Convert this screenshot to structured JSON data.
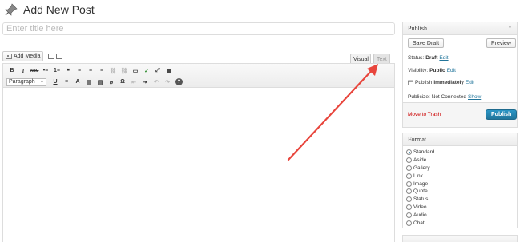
{
  "page": {
    "title": "Add New Post"
  },
  "title_field": {
    "placeholder": "Enter title here"
  },
  "media": {
    "add_media_label": "Add Media"
  },
  "editor_tabs": {
    "visual": "Visual",
    "text": "Text"
  },
  "toolbar": {
    "row1": [
      "B",
      "I",
      "ABC",
      "•≡",
      "1≡",
      "❝",
      "≡",
      "≡",
      "≡",
      "⛓",
      "⛓",
      "▭",
      "✓",
      "⤢",
      "▦"
    ],
    "paragraph_select": "Paragraph",
    "row2": [
      "U",
      "≡",
      "A",
      "▤",
      "▤",
      "⌀",
      "Ω",
      "⇤",
      "⇥",
      "↶",
      "↷",
      "?"
    ]
  },
  "publish_box": {
    "title": "Publish",
    "save_draft": "Save Draft",
    "preview": "Preview",
    "status_label": "Status:",
    "status_value": "Draft",
    "status_edit": "Edit",
    "visibility_label": "Visibility:",
    "visibility_value": "Public",
    "visibility_edit": "Edit",
    "publish_label": "Publish",
    "publish_value": "immediately",
    "publish_edit": "Edit",
    "publicize_label": "Publicize: Not Connected",
    "publicize_show": "Show",
    "move_to_trash": "Move to Trash",
    "publish_button": "Publish"
  },
  "format_box": {
    "title": "Format",
    "options": [
      "Standard",
      "Aside",
      "Gallery",
      "Link",
      "Image",
      "Quote",
      "Status",
      "Video",
      "Audio",
      "Chat"
    ],
    "selected": "Standard"
  },
  "colors": {
    "link": "#21759b",
    "publish": "#21759b",
    "trash": "#cc0000",
    "annotation_arrow": "#e8453c"
  }
}
